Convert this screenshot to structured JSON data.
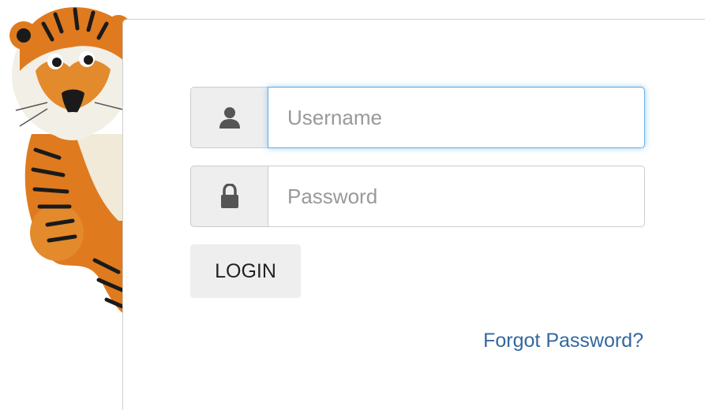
{
  "login": {
    "username_placeholder": "Username",
    "username_value": "",
    "password_placeholder": "Password",
    "password_value": "",
    "login_label": "LOGIN",
    "forgot_label": "Forgot Password?"
  },
  "icons": {
    "username": "user-icon",
    "password": "lock-icon",
    "mascot": "tiger-mascot"
  },
  "colors": {
    "link": "#33689e",
    "focus_border": "#66afe9",
    "addon_bg": "#eeeeee",
    "mascot_orange": "#e07a1f"
  }
}
